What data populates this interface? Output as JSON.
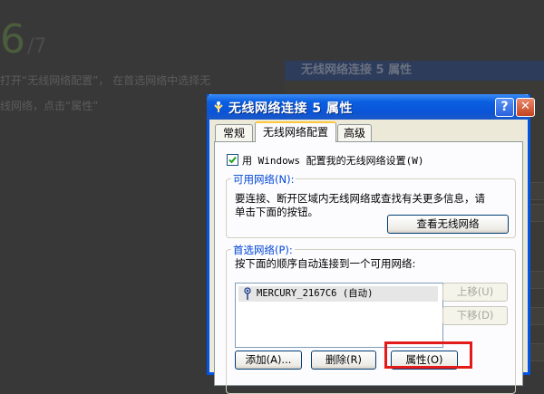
{
  "background": {
    "step_number": "6",
    "step_total": "/7",
    "instruction_line1": "打开“无线网络配置”， 在首选网络中选择无",
    "instruction_line2": "线网络，点击“属性”",
    "bg_window_title": "无线网络连接 5 属性"
  },
  "dialog": {
    "title": "无线网络连接 5 属性",
    "help_label": "?",
    "close_label": "✕",
    "tabs": [
      {
        "label": "常规",
        "active": false
      },
      {
        "label": "无线网络配置",
        "active": true
      },
      {
        "label": "高级",
        "active": false
      }
    ],
    "use_windows_checkbox": {
      "label": "用 Windows 配置我的无线网络设置(W)",
      "checked": true
    },
    "available_networks": {
      "legend": "可用网络(N):",
      "description_line1": "要连接、断开区域内无线网络或查找有关更多信息，请",
      "description_line2": "单击下面的按钮。",
      "view_button": "查看无线网络"
    },
    "preferred_networks": {
      "legend": "首选网络(P):",
      "description": "按下面的顺序自动连接到一个可用网络:",
      "items": [
        {
          "icon": "wireless-antenna-icon",
          "text": "MERCURY_2167C6 (自动)"
        }
      ],
      "move_up_button": "上移(U)",
      "move_down_button": "下移(D)",
      "add_button": "添加(A)...",
      "remove_button": "删除(R)",
      "properties_button": "属性(O)"
    }
  },
  "colors": {
    "titlebar_blue": "#0a54d8",
    "dialog_face": "#ece9d8",
    "highlight_red": "#e31a1a",
    "active_tab_accent": "#ffc73c",
    "groupbox_legend": "#0046d5"
  }
}
